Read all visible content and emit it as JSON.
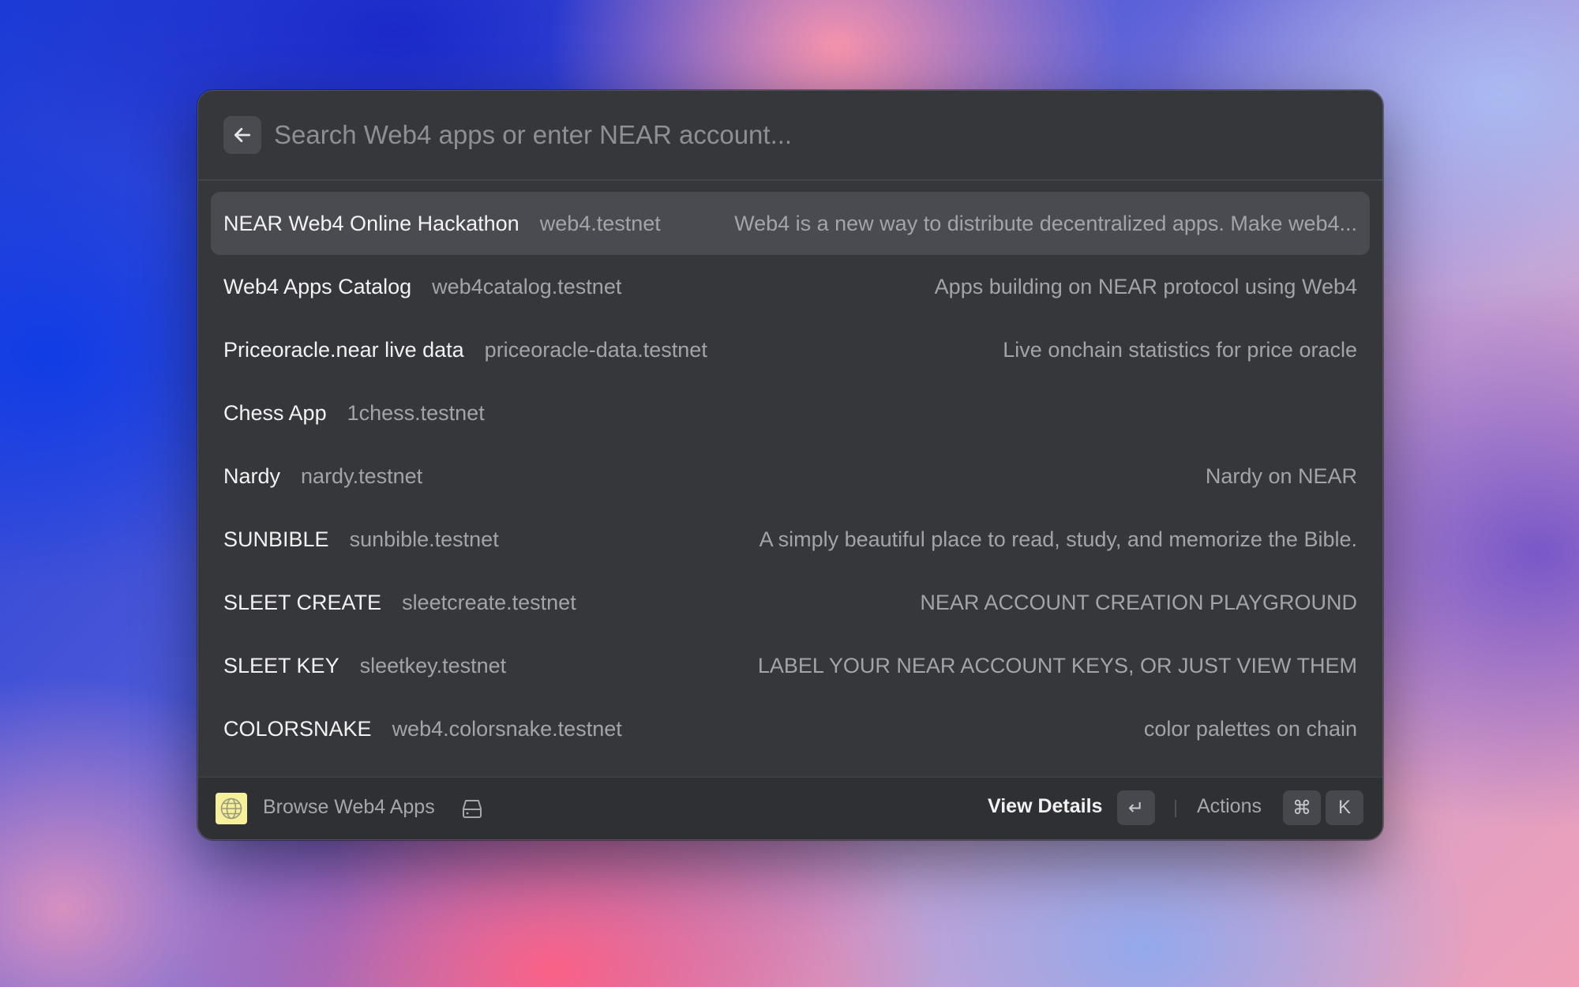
{
  "search": {
    "placeholder": "Search Web4 apps or enter NEAR account...",
    "back_icon": "arrow-left-icon"
  },
  "items": [
    {
      "title": "NEAR Web4 Online Hackathon",
      "account": "web4.testnet",
      "description": "Web4 is a new way to distribute decentralized apps. Make web4...",
      "selected": true
    },
    {
      "title": "Web4 Apps Catalog",
      "account": "web4catalog.testnet",
      "description": "Apps building on NEAR protocol using Web4",
      "selected": false
    },
    {
      "title": "Priceoracle.near live data",
      "account": "priceoracle-data.testnet",
      "description": "Live onchain statistics for price oracle",
      "selected": false
    },
    {
      "title": "Chess App",
      "account": "1chess.testnet",
      "description": "",
      "selected": false
    },
    {
      "title": "Nardy",
      "account": "nardy.testnet",
      "description": "Nardy on NEAR",
      "selected": false
    },
    {
      "title": "SUNBIBLE",
      "account": "sunbible.testnet",
      "description": "A simply beautiful place to read, study, and memorize the Bible.",
      "selected": false
    },
    {
      "title": "SLEET CREATE",
      "account": "sleetcreate.testnet",
      "description": "NEAR ACCOUNT CREATION PLAYGROUND",
      "selected": false
    },
    {
      "title": "SLEET KEY",
      "account": "sleetkey.testnet",
      "description": "LABEL YOUR NEAR ACCOUNT KEYS, OR JUST VIEW THEM",
      "selected": false
    },
    {
      "title": "COLORSNAKE",
      "account": "web4.colorsnake.testnet",
      "description": "color palettes on chain",
      "selected": false
    }
  ],
  "footer": {
    "icon": "globe-icon",
    "title": "Browse Web4 Apps",
    "status_icon": "hard-drive-icon",
    "primary_action": "View Details",
    "primary_key": "↵",
    "actions_label": "Actions",
    "actions_keys": [
      "⌘",
      "K"
    ]
  },
  "colors": {
    "window_bg": "#36373b",
    "selected_row": "#4a4b50",
    "footer_bg": "#2f3034",
    "extension_icon_bg": "#f7f09a"
  }
}
